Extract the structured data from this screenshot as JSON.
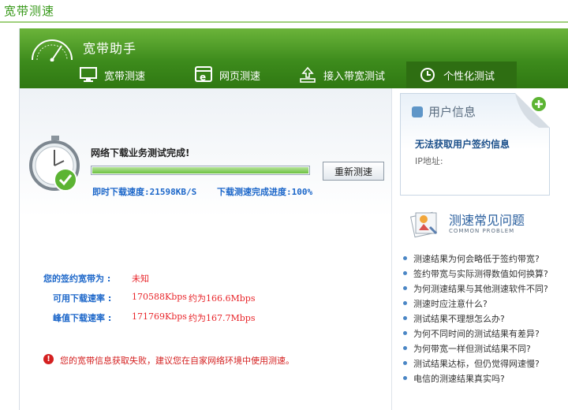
{
  "page": {
    "title": "宽带测速"
  },
  "app": {
    "name": "宽带助手"
  },
  "nav": {
    "tabs": [
      {
        "label": "宽带测速",
        "icon": "monitor-icon"
      },
      {
        "label": "网页测速",
        "icon": "browser-icon"
      },
      {
        "label": "接入带宽测试",
        "icon": "upload-icon"
      },
      {
        "label": "个性化测试",
        "icon": "clock-icon",
        "active": true
      }
    ]
  },
  "test": {
    "status": "网络下载业务测试完成!",
    "progress_percent": 100,
    "retest_label": "重新测速",
    "instant_speed": "即时下载速度:21598KB/S",
    "completion": "下载测速完成进度:100%"
  },
  "contract": {
    "bandwidth_label": "您的签约宽带为 :",
    "bandwidth_value": "未知",
    "available_label": "可用下载速率 :",
    "available_kbps": "170588Kbps",
    "available_mbps": "约为166.6Mbps",
    "peak_label": "峰值下载速率 :",
    "peak_kbps": "171769Kbps",
    "peak_mbps": "约为167.7Mbps"
  },
  "error": {
    "message": "您的宽带信息获取失败，建议您在自家网络环境中使用测速。"
  },
  "user_info": {
    "title": "用户信息",
    "message": "无法获取用户签约信息",
    "ip_label": "IP地址:"
  },
  "faq": {
    "title": "测速常见问题",
    "subtitle": "COMMON PROBLEM",
    "items": [
      "测速结果为何会略低于签约带宽?",
      "签约带宽与实际测得数值如何换算?",
      "为何测速结果与其他测速软件不同?",
      "测速时应注意什么?",
      "测试结果不理想怎么办?",
      "为何不同时间的测试结果有差异?",
      "为何带宽一样但测试结果不同?",
      "测试结果达标，但仍觉得网速慢?",
      "电信的测速结果真实吗?"
    ]
  },
  "colors": {
    "header_green": "#3d8b1c",
    "link_blue": "#1b66c9",
    "error_red": "#d42020"
  }
}
